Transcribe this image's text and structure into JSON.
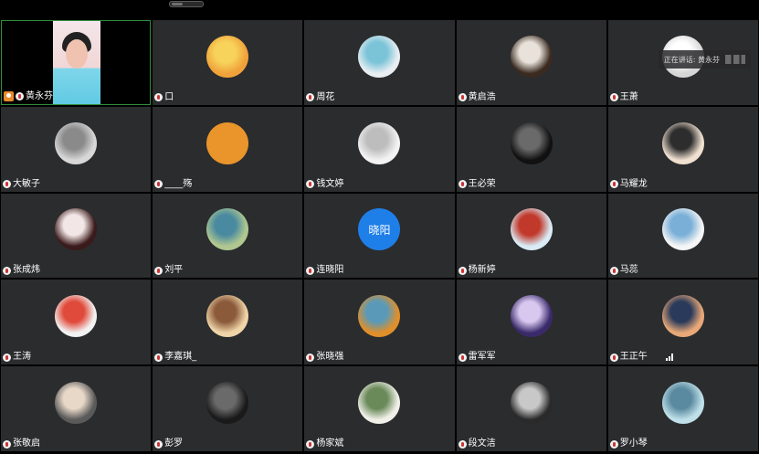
{
  "speaking_indicator": {
    "label": "正在讲话: 黄永芬"
  },
  "participants": [
    {
      "name": "黄永芬",
      "is_host": true,
      "video_on": true
    },
    {
      "name": "口",
      "avatar_colors": [
        "#f0a23a",
        "#f7d35b"
      ]
    },
    {
      "name": "周花",
      "avatar_colors": [
        "#e8eef2",
        "#7bc4d8"
      ]
    },
    {
      "name": "黄启浩",
      "avatar_colors": [
        "#3a2a20",
        "#e8e2da"
      ]
    },
    {
      "name": "王萧",
      "avatar_colors": [
        "#d6d6d6",
        "#ffffff"
      ]
    },
    {
      "name": "大敏子",
      "avatar_colors": [
        "#d8d8d8",
        "#8a8a8a"
      ]
    },
    {
      "name": "____殇",
      "avatar_colors": [
        "#e9952b",
        "#e9952b"
      ]
    },
    {
      "name": "钱文婷",
      "avatar_colors": [
        "#f3f3f3",
        "#bdbdbd"
      ]
    },
    {
      "name": "王必荣",
      "avatar_colors": [
        "#111111",
        "#6a6a6a"
      ]
    },
    {
      "name": "马耀龙",
      "avatar_colors": [
        "#f0e0d0",
        "#2d2d2d"
      ]
    },
    {
      "name": "张成炜",
      "avatar_colors": [
        "#3a1a1a",
        "#f3e6e6"
      ]
    },
    {
      "name": "刘平",
      "avatar_colors": [
        "#b0c890",
        "#4a8aa0"
      ]
    },
    {
      "name": "连晓阳",
      "avatar_text": "晓阳",
      "avatar_colors": [
        "#1f7fe8",
        "#1f7fe8"
      ]
    },
    {
      "name": "杨新婷",
      "avatar_colors": [
        "#d9ecf5",
        "#c0392b"
      ]
    },
    {
      "name": "马蕊",
      "avatar_colors": [
        "#f5f5f5",
        "#7ab0d8"
      ]
    },
    {
      "name": "王涛",
      "avatar_colors": [
        "#f2f2f2",
        "#e04a3a"
      ]
    },
    {
      "name": "李嘉琪_",
      "avatar_colors": [
        "#f0d5a8",
        "#8a5a3a"
      ]
    },
    {
      "name": "张晓强",
      "avatar_colors": [
        "#e08f2a",
        "#5a9ab8"
      ]
    },
    {
      "name": "雷军军",
      "avatar_colors": [
        "#3a2a6a",
        "#d8c8f0"
      ]
    },
    {
      "name": "王正午",
      "avatar_colors": [
        "#e8a878",
        "#2a3a5a"
      ],
      "signal": true
    },
    {
      "name": "张敬启",
      "avatar_colors": [
        "#5a5a5a",
        "#e8d8c8"
      ]
    },
    {
      "name": "彭罗",
      "avatar_colors": [
        "#1a1a1a",
        "#6a6a6a"
      ]
    },
    {
      "name": "杨家斌",
      "avatar_colors": [
        "#f0f0e8",
        "#6a8a5a"
      ]
    },
    {
      "name": "段文洁",
      "avatar_colors": [
        "#2a2a2a",
        "#c8c8c8"
      ]
    },
    {
      "name": "罗小琴",
      "avatar_colors": [
        "#bfe0e8",
        "#5a8aa0"
      ]
    }
  ]
}
